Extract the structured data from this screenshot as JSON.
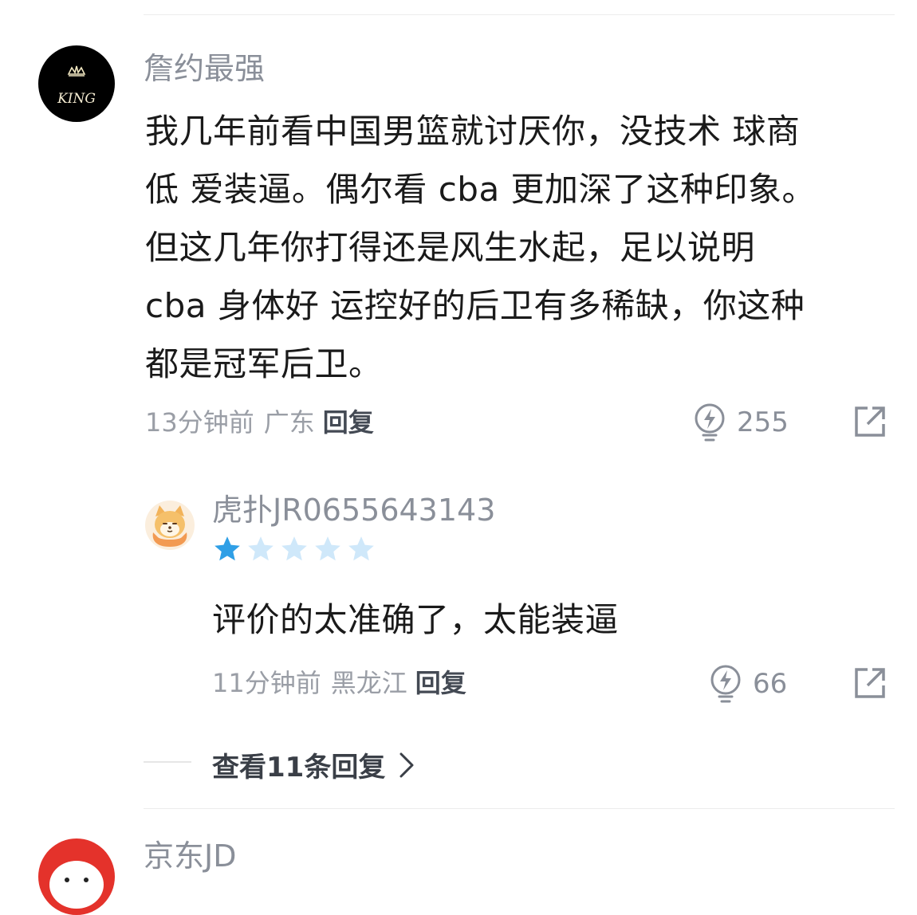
{
  "comment": {
    "username": "詹约最强",
    "avatar_text": "KING",
    "text_lines": [
      "我几年前看中国男篮就讨厌你，没技术 球商",
      "低 爱装逼。偶尔看 cba 更加深了这种印象。",
      "但这几年你打得还是风生水起，足以说明",
      " cba 身体好 运控好的后卫有多稀缺，你这种",
      "都是冠军后卫。"
    ],
    "time": "13分钟前",
    "region": "广东",
    "reply_label": "回复",
    "light_count": "255"
  },
  "reply": {
    "username": "虎扑JR0655643143",
    "rating": 1,
    "rating_max": 5,
    "text": "评价的太准确了，太能装逼",
    "time": "11分钟前",
    "region": "黑龙江",
    "reply_label": "回复",
    "light_count": "66"
  },
  "view_more": {
    "label": "查看11条回复"
  },
  "next_comment": {
    "username": "京东JD"
  },
  "colors": {
    "star_filled": "#2f9fe6",
    "star_empty": "#cfe8fa",
    "muted_text": "#8a8f99"
  }
}
